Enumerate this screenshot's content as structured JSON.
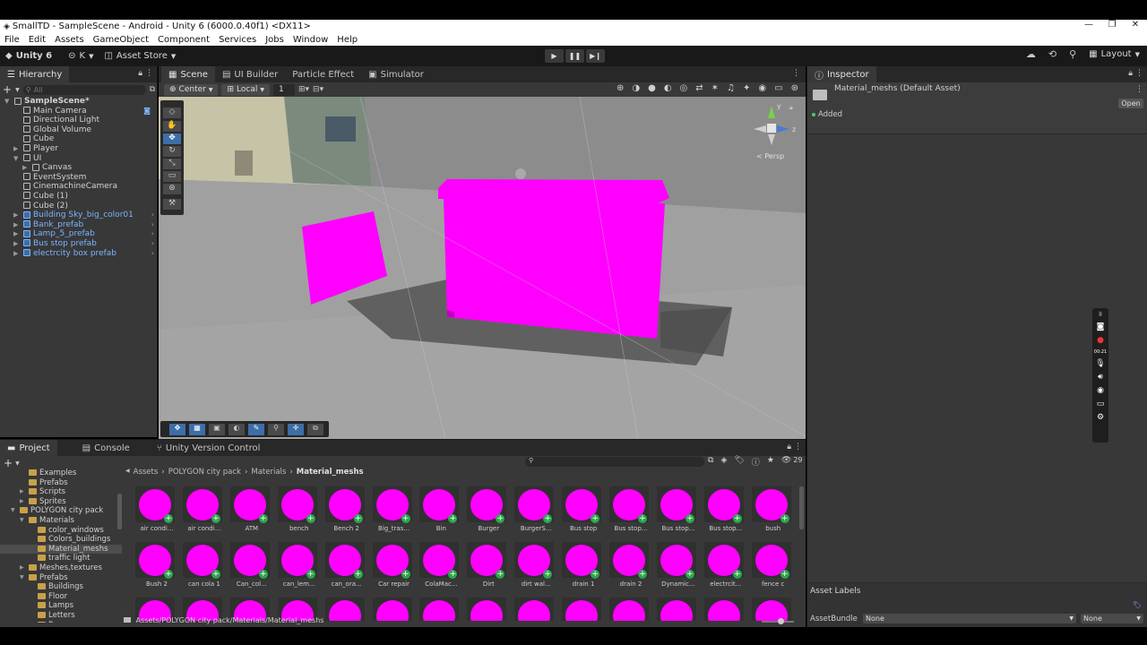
{
  "window": {
    "title": "SmallTD - SampleScene - Android - Unity 6 (6000.0.40f1) <DX11>",
    "controls": [
      "—",
      "❐",
      "✕"
    ]
  },
  "menu": [
    "File",
    "Edit",
    "Assets",
    "GameObject",
    "Component",
    "Services",
    "Jobs",
    "Window",
    "Help"
  ],
  "toolbar": {
    "unity_label": "Unity 6",
    "account_label": "K",
    "asset_store_label": "Asset Store",
    "layout_label": "Layout"
  },
  "hierarchy": {
    "tab_label": "Hierarchy",
    "search_placeholder": "All",
    "items": [
      {
        "label": "SampleScene*",
        "depth": 0,
        "type": "scene",
        "arrow": "▼"
      },
      {
        "label": "Main Camera",
        "depth": 1,
        "type": "go"
      },
      {
        "label": "Directional Light",
        "depth": 1,
        "type": "go"
      },
      {
        "label": "Global Volume",
        "depth": 1,
        "type": "go"
      },
      {
        "label": "Cube",
        "depth": 1,
        "type": "go"
      },
      {
        "label": "Player",
        "depth": 1,
        "type": "go",
        "arrow": "▶"
      },
      {
        "label": "UI",
        "depth": 1,
        "type": "go",
        "arrow": "▼"
      },
      {
        "label": "Canvas",
        "depth": 2,
        "type": "go",
        "arrow": "▶"
      },
      {
        "label": "EventSystem",
        "depth": 1,
        "type": "go"
      },
      {
        "label": "CinemachineCamera",
        "depth": 1,
        "type": "go"
      },
      {
        "label": "Cube (1)",
        "depth": 1,
        "type": "go"
      },
      {
        "label": "Cube (2)",
        "depth": 1,
        "type": "go"
      },
      {
        "label": "Building Sky_big_color01",
        "depth": 1,
        "type": "prefab",
        "arrow": "▶"
      },
      {
        "label": "Bank_prefab",
        "depth": 1,
        "type": "prefab",
        "arrow": "▶"
      },
      {
        "label": "Lamp_5_prefab",
        "depth": 1,
        "type": "prefab",
        "arrow": "▶"
      },
      {
        "label": "Bus stop prefab",
        "depth": 1,
        "type": "prefab",
        "arrow": "▶"
      },
      {
        "label": "electrcity box prefab",
        "depth": 1,
        "type": "prefab",
        "arrow": "▶"
      }
    ]
  },
  "scene": {
    "tabs": [
      {
        "label": "Scene",
        "active": true
      },
      {
        "label": "UI Builder",
        "active": false
      },
      {
        "label": "Particle Effect",
        "active": false
      },
      {
        "label": "Simulator",
        "active": false
      }
    ],
    "pivot_label": "Center",
    "space_label": "Local",
    "snap_value": "1",
    "persp_label": "< Persp",
    "gizmo_axes": {
      "y": "y",
      "z": "z"
    }
  },
  "inspector": {
    "tab_label": "Inspector",
    "asset_title": "Material_meshs (Default Asset)",
    "open_label": "Open",
    "added_label": "Added",
    "asset_labels_title": "Asset Labels",
    "assetbundle_label": "AssetBundle",
    "assetbundle_value": "None",
    "variant_value": "None"
  },
  "recorder": {
    "time": "00:21"
  },
  "project": {
    "tabs": [
      {
        "label": "Project",
        "active": true
      },
      {
        "label": "Console",
        "active": false
      },
      {
        "label": "Unity Version Control",
        "active": false
      }
    ],
    "hidden_count": "29",
    "breadcrumb": [
      "Assets",
      "POLYGON city pack",
      "Materials",
      "Material_meshs"
    ],
    "path_footer": "Assets/POLYGON city pack/Materials/Material_meshs",
    "tree": [
      {
        "label": "Examples",
        "depth": 2,
        "arrow": ""
      },
      {
        "label": "Prefabs",
        "depth": 2,
        "arrow": ""
      },
      {
        "label": "Scripts",
        "depth": 2,
        "arrow": "▶"
      },
      {
        "label": "Sprites",
        "depth": 2,
        "arrow": "▶"
      },
      {
        "label": "POLYGON city pack",
        "depth": 1,
        "arrow": "▼"
      },
      {
        "label": "Materials",
        "depth": 2,
        "arrow": "▼"
      },
      {
        "label": "color_windows",
        "depth": 3,
        "arrow": ""
      },
      {
        "label": "Colors_buildings",
        "depth": 3,
        "arrow": ""
      },
      {
        "label": "Material_meshs",
        "depth": 3,
        "arrow": "",
        "selected": true
      },
      {
        "label": "traffic light",
        "depth": 3,
        "arrow": ""
      },
      {
        "label": "Meshes,textures",
        "depth": 2,
        "arrow": "▶"
      },
      {
        "label": "Prefabs",
        "depth": 2,
        "arrow": "▼"
      },
      {
        "label": "Buildings",
        "depth": 3,
        "arrow": ""
      },
      {
        "label": "Floor",
        "depth": 3,
        "arrow": ""
      },
      {
        "label": "Lamps",
        "depth": 3,
        "arrow": ""
      },
      {
        "label": "Letters",
        "depth": 3,
        "arrow": ""
      },
      {
        "label": "Props",
        "depth": 3,
        "arrow": ""
      }
    ],
    "assets_row1": [
      "air condi...",
      "air condi...",
      "ATM",
      "bench",
      "Bench 2",
      "Big_tras...",
      "Bin",
      "Burger",
      "BurgerS...",
      "Bus stop",
      "Bus stop...",
      "Bus stop...",
      "Bus stop...",
      "bush"
    ],
    "assets_row2": [
      "Bush 2",
      "can cola 1",
      "Can_col...",
      "can_lem...",
      "can_ora...",
      "Car repair",
      "ColaMac...",
      "Dirt",
      "dirt wal...",
      "drain 1",
      "drain 2",
      "Dynamic...",
      "electrcit...",
      "fence c"
    ]
  },
  "colors": {
    "accent": "#3d6ea8",
    "material": "#ff00ff",
    "prefab_text": "#7cb4ff"
  }
}
